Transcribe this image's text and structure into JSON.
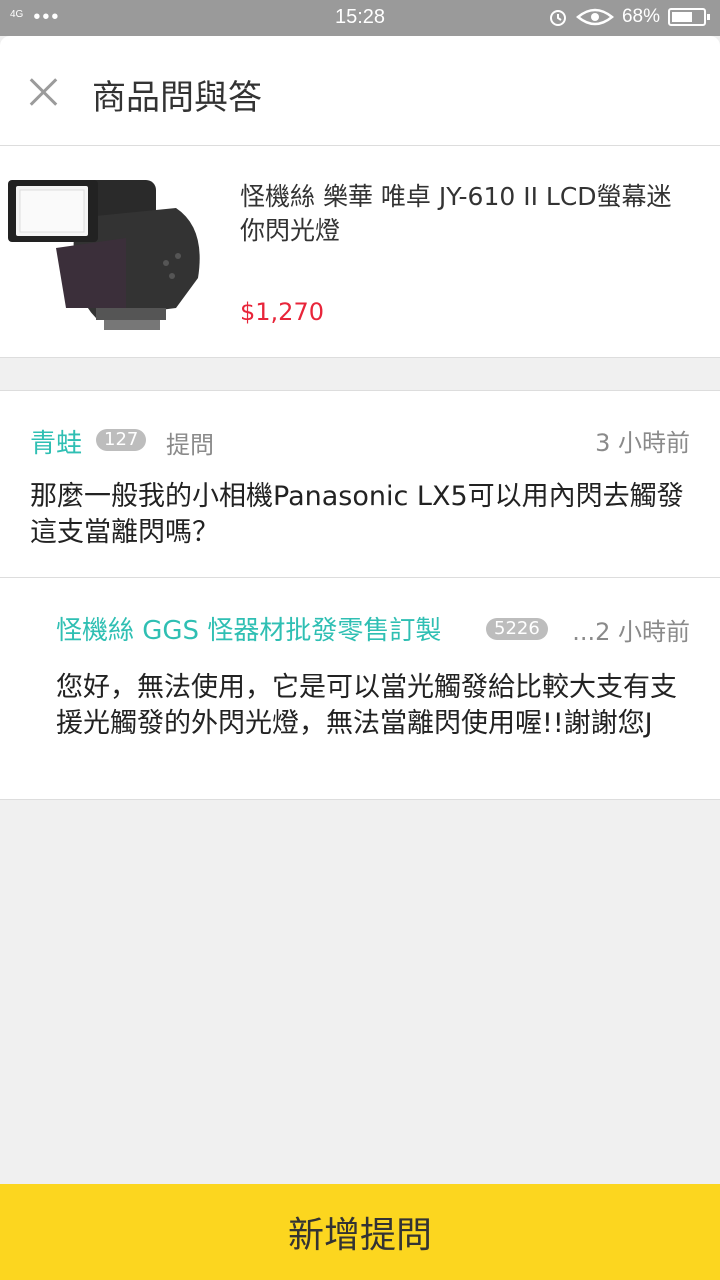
{
  "status_bar": {
    "network": "4G",
    "dots": "•••",
    "time": "15:28",
    "battery": "68%",
    "battery_level": 0.68
  },
  "header": {
    "title": "商品問與答"
  },
  "product": {
    "name": "怪機絲 樂華 唯卓 JY-610 II LCD螢幕迷你閃光燈",
    "price": "$1,270"
  },
  "question": {
    "user": "青蛙",
    "badge": "127",
    "tag": "提問",
    "time": "3 小時前",
    "text": "那麼一般我的小相機Panasonic LX5可以用內閃去觸發這支當離閃嗎？"
  },
  "answer": {
    "user": "怪機絲 GGS 怪器材批發零售訂製",
    "badge": "5226",
    "time": "...2 小時前",
    "text": "您好，無法使用，它是可以當光觸發給比較大支有支援光觸發的外閃光燈，無法當離閃使用喔!!謝謝您J"
  },
  "footer": {
    "add_question_label": "新增提問"
  }
}
